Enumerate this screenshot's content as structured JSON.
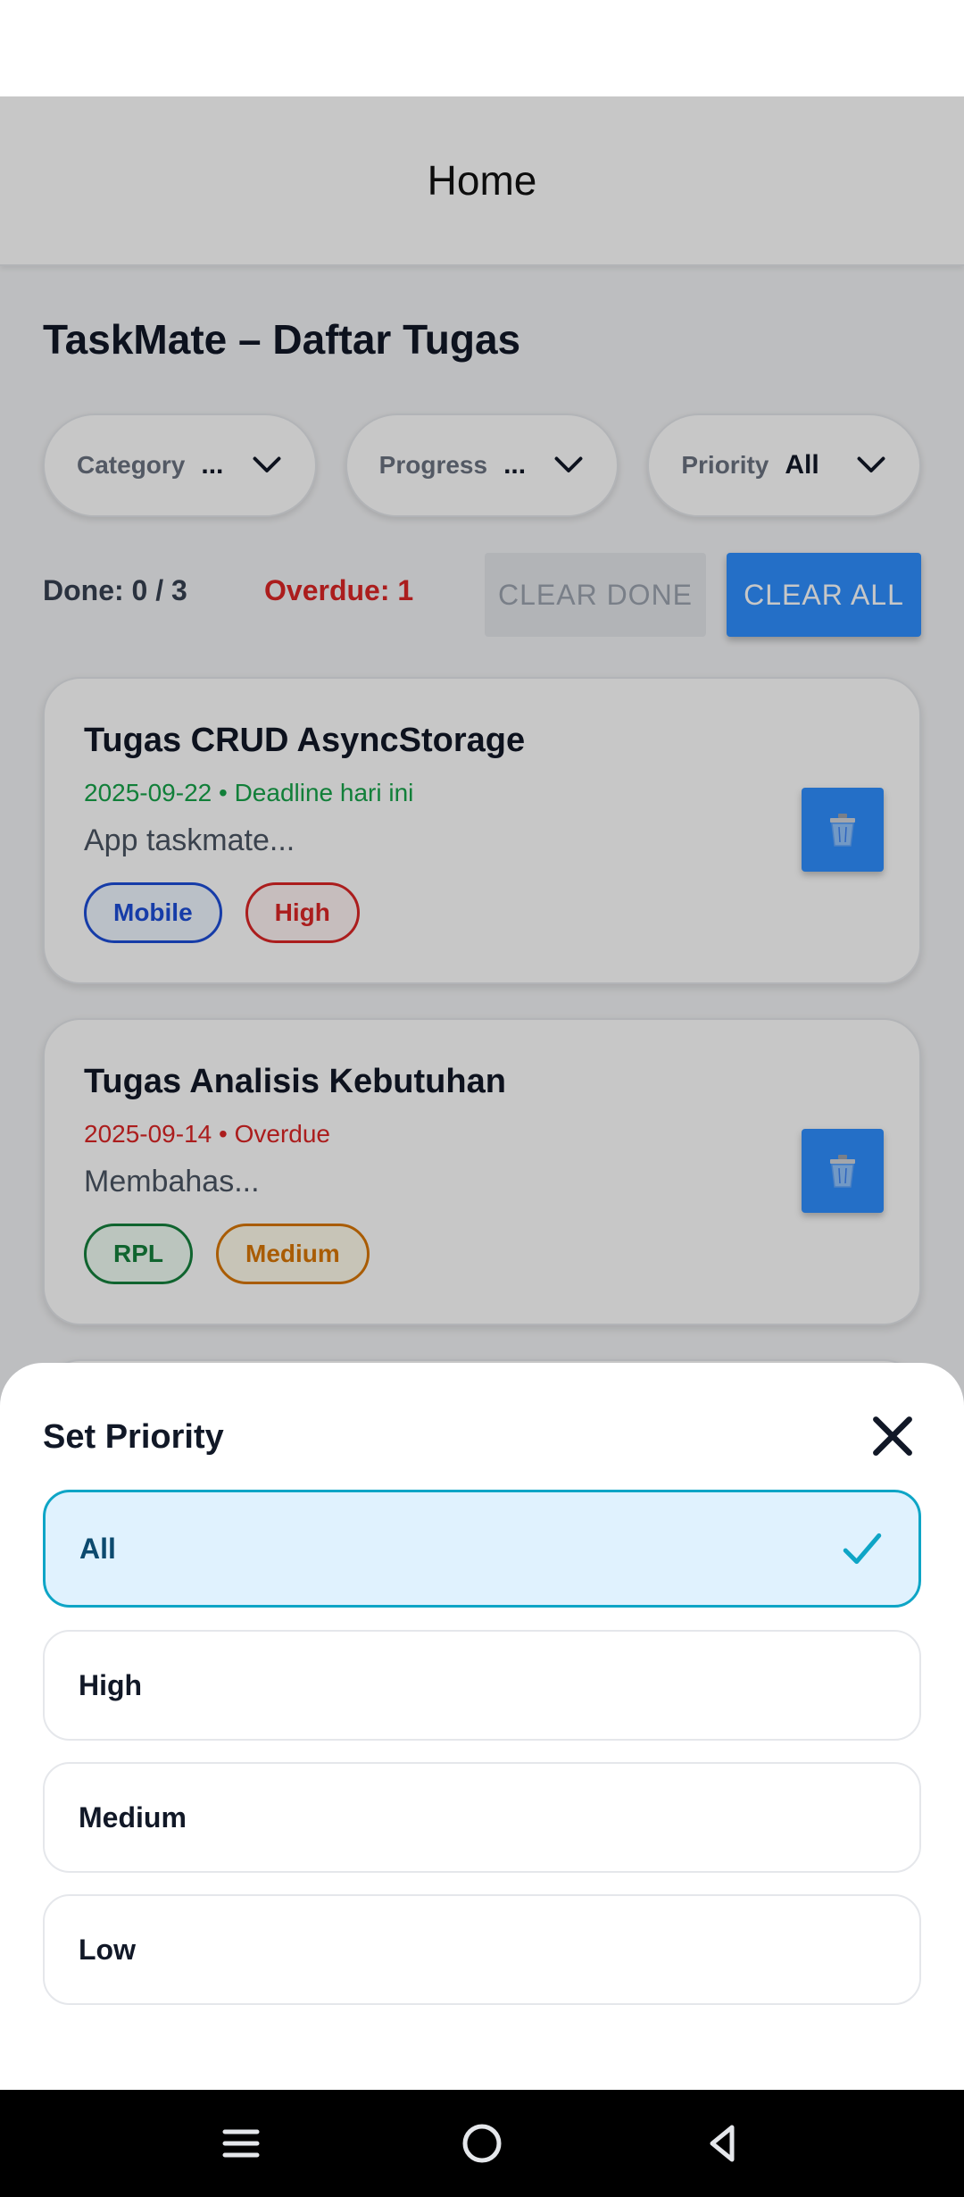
{
  "header": {
    "title": "Home"
  },
  "page_title": "TaskMate – Daftar Tugas",
  "filters": [
    {
      "label": "Category",
      "value": "..."
    },
    {
      "label": "Progress",
      "value": "..."
    },
    {
      "label": "Priority",
      "value": "All"
    }
  ],
  "stats": {
    "done": "Done: 0 / 3",
    "overdue": "Overdue: 1",
    "clear_done_label": "CLEAR DONE",
    "clear_all_label": "CLEAR ALL"
  },
  "tasks": [
    {
      "title": "Tugas CRUD AsyncStorage",
      "meta": "2025-09-22 • Deadline hari ini",
      "meta_color": "#16a34a",
      "description": "App taskmate...",
      "tags": [
        {
          "label": "Mobile",
          "color": "#1d4ed8",
          "bg": "#eff6ff"
        },
        {
          "label": "High",
          "color": "#dc2626",
          "bg": "#fef2f2"
        }
      ]
    },
    {
      "title": "Tugas Analisis Kebutuhan",
      "meta": "2025-09-14 • Overdue",
      "meta_color": "#dc2626",
      "description": "Membahas...",
      "tags": [
        {
          "label": "RPL",
          "color": "#15803d",
          "bg": "#f0fdf4"
        },
        {
          "label": "Medium",
          "color": "#d97706",
          "bg": "#fffbeb"
        }
      ]
    }
  ],
  "sheet": {
    "title": "Set Priority",
    "options": [
      {
        "label": "All",
        "selected": true
      },
      {
        "label": "High",
        "selected": false
      },
      {
        "label": "Medium",
        "selected": false
      },
      {
        "label": "Low",
        "selected": false
      }
    ]
  },
  "colors": {
    "accent": "#2f8fff",
    "overdue": "#dc2626",
    "selected_border": "#0ea5c6",
    "selected_bg": "#e0f2fe"
  },
  "icons": [
    "chevron-down-icon",
    "trash-icon",
    "close-icon",
    "check-icon",
    "menu-icon",
    "home-circle-icon",
    "back-triangle-icon"
  ]
}
